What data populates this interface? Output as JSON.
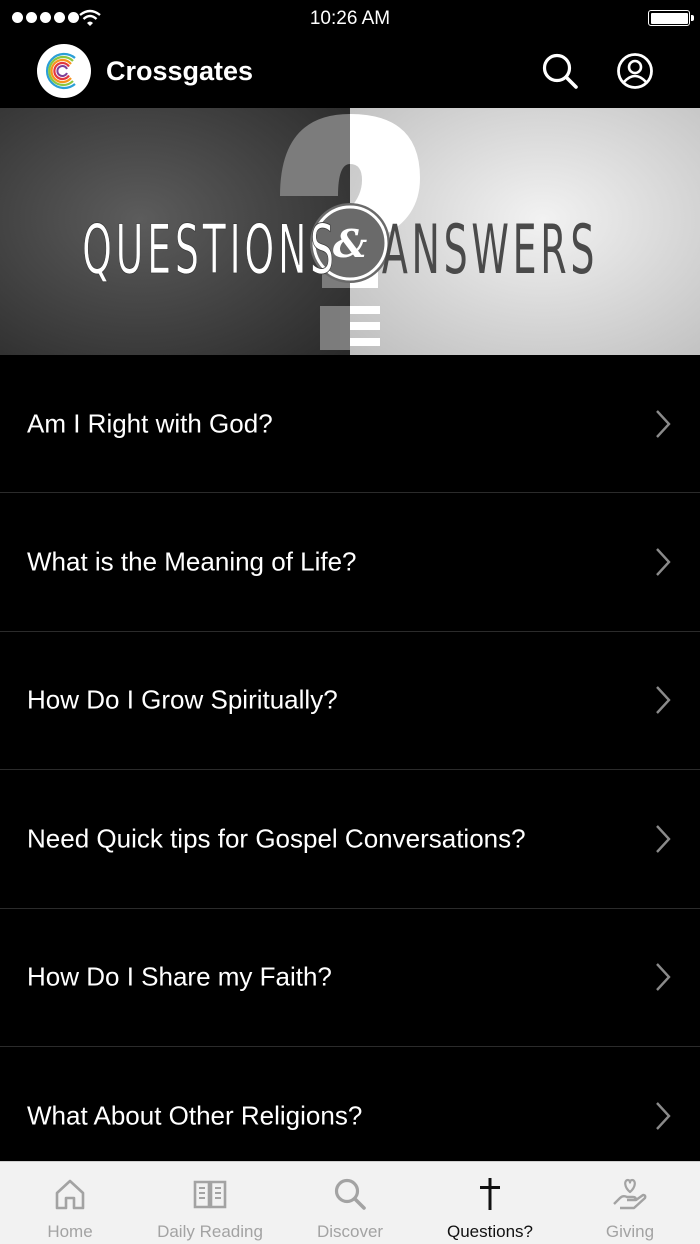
{
  "status_bar": {
    "time": "10:26 AM"
  },
  "header": {
    "title": "Crossgates"
  },
  "banner": {
    "left_word": "QUESTIONS",
    "ampersand": "&",
    "right_word": "ANSWERS"
  },
  "questions": [
    {
      "label": "Am I Right with God?"
    },
    {
      "label": "What is the Meaning of Life?"
    },
    {
      "label": "How Do I Grow Spiritually?"
    },
    {
      "label": "Need Quick tips for Gospel Conversations?"
    },
    {
      "label": "How Do I Share my Faith?"
    },
    {
      "label": "What About Other Religions?"
    }
  ],
  "tabs": [
    {
      "label": "Home",
      "icon": "home-icon"
    },
    {
      "label": "Daily Reading",
      "icon": "book-icon"
    },
    {
      "label": "Discover",
      "icon": "search-icon"
    },
    {
      "label": "Questions?",
      "icon": "cross-icon",
      "active": true
    },
    {
      "label": "Giving",
      "icon": "giving-hand-icon"
    }
  ],
  "colors": {
    "background": "#000000",
    "tab_bar": "#f2f2f2",
    "tab_inactive": "#a3a3a3",
    "tab_active": "#111111"
  }
}
